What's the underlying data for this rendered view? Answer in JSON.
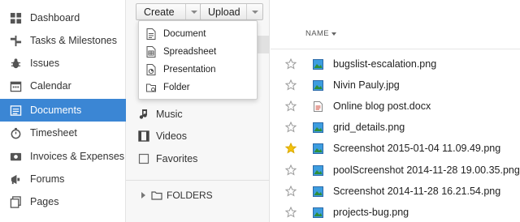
{
  "nav": {
    "items": [
      {
        "label": "Dashboard",
        "icon": "dashboard-icon"
      },
      {
        "label": "Tasks & Milestones",
        "icon": "tasks-icon"
      },
      {
        "label": "Issues",
        "icon": "bug-icon"
      },
      {
        "label": "Calendar",
        "icon": "calendar-icon"
      },
      {
        "label": "Documents",
        "icon": "documents-icon",
        "active": true
      },
      {
        "label": "Timesheet",
        "icon": "stopwatch-icon"
      },
      {
        "label": "Invoices & Expenses",
        "icon": "invoice-icon"
      },
      {
        "label": "Forums",
        "icon": "megaphone-icon"
      },
      {
        "label": "Pages",
        "icon": "pages-icon"
      }
    ]
  },
  "toolbar": {
    "create_label": "Create",
    "upload_label": "Upload"
  },
  "create_menu": {
    "items": [
      {
        "label": "Document",
        "icon": "document-icon"
      },
      {
        "label": "Spreadsheet",
        "icon": "spreadsheet-icon"
      },
      {
        "label": "Presentation",
        "icon": "presentation-icon"
      },
      {
        "label": "Folder",
        "icon": "folder-icon"
      }
    ]
  },
  "library": {
    "items": [
      {
        "label": "Music",
        "icon": "music-note-icon"
      },
      {
        "label": "Videos",
        "icon": "film-icon"
      },
      {
        "label": "Favorites",
        "icon": "favorites-icon"
      }
    ],
    "folders_label": "FOLDERS"
  },
  "file_list": {
    "column_header": "NAME",
    "files": [
      {
        "name": "bugslist-escalation.png",
        "type": "image",
        "starred": false
      },
      {
        "name": "Nivin Pauly.jpg",
        "type": "image",
        "starred": false
      },
      {
        "name": "Online blog post.docx",
        "type": "document",
        "starred": false
      },
      {
        "name": "grid_details.png",
        "type": "image",
        "starred": false
      },
      {
        "name": "Screenshot 2015-01-04 11.09.49.png",
        "type": "image",
        "starred": true
      },
      {
        "name": "poolScreenshot 2014-11-28 19.00.35.png",
        "type": "image",
        "starred": false
      },
      {
        "name": "Screenshot 2014-11-28 16.21.54.png",
        "type": "image",
        "starred": false
      },
      {
        "name": "projects-bug.png",
        "type": "image",
        "starred": false
      }
    ]
  },
  "colors": {
    "active_nav_bg": "#3b86d4",
    "star_active": "#f4c20d",
    "star_inactive": "#9a9a9a"
  }
}
